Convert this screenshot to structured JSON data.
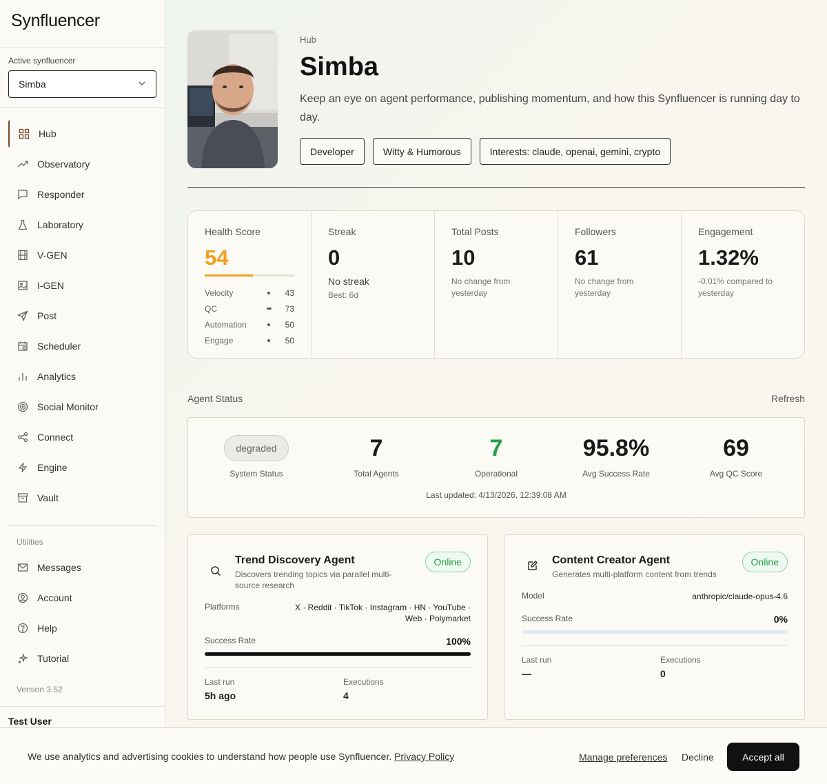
{
  "app": {
    "brand": "Synfluencer"
  },
  "sidebar": {
    "active_label": "Active synfluencer",
    "active_value": "Simba",
    "items": [
      {
        "label": "Hub",
        "icon": "grid-icon"
      },
      {
        "label": "Observatory",
        "icon": "trend-icon"
      },
      {
        "label": "Responder",
        "icon": "chat-icon"
      },
      {
        "label": "Laboratory",
        "icon": "flask-icon"
      },
      {
        "label": "V-GEN",
        "icon": "film-icon"
      },
      {
        "label": "I-GEN",
        "icon": "image-icon"
      },
      {
        "label": "Post",
        "icon": "send-icon"
      },
      {
        "label": "Scheduler",
        "icon": "calendar-icon"
      },
      {
        "label": "Analytics",
        "icon": "bar-chart-icon"
      },
      {
        "label": "Social Monitor",
        "icon": "radar-icon"
      },
      {
        "label": "Connect",
        "icon": "share-icon"
      },
      {
        "label": "Engine",
        "icon": "bolt-icon"
      },
      {
        "label": "Vault",
        "icon": "archive-icon"
      }
    ],
    "utilities_label": "Utilities",
    "utilities": [
      {
        "label": "Messages",
        "icon": "mail-icon"
      },
      {
        "label": "Account",
        "icon": "user-circle-icon"
      },
      {
        "label": "Help",
        "icon": "help-icon"
      },
      {
        "label": "Tutorial",
        "icon": "sparkle-icon"
      }
    ],
    "version": "Version 3.52",
    "user": "Test User"
  },
  "profile": {
    "section": "Hub",
    "name": "Simba",
    "description": "Keep an eye on agent performance, publishing momentum, and how this Synfluencer is running day to day.",
    "tags": [
      "Developer",
      "Witty & Humorous",
      "Interests: claude, openai, gemini, crypto"
    ]
  },
  "stats": {
    "health": {
      "label": "Health Score",
      "value": "54",
      "fill": 0.54,
      "breakdown": [
        {
          "label": "Velocity",
          "value": "43"
        },
        {
          "label": "QC",
          "value": "73"
        },
        {
          "label": "Automation",
          "value": "50"
        },
        {
          "label": "Engage",
          "value": "50"
        }
      ]
    },
    "streak": {
      "label": "Streak",
      "value": "0",
      "sub": "No streak",
      "note": "Best: 6d"
    },
    "posts": {
      "label": "Total Posts",
      "value": "10",
      "note": "No change from yesterday"
    },
    "followers": {
      "label": "Followers",
      "value": "61",
      "note": "No change from yesterday"
    },
    "engagement": {
      "label": "Engagement",
      "value": "1.32%",
      "note": "-0.01% compared to yesterday"
    }
  },
  "agent_status": {
    "title": "Agent Status",
    "refresh": "Refresh",
    "system_status": "degraded",
    "system_status_label": "System Status",
    "total_agents": "7",
    "total_agents_label": "Total Agents",
    "operational": "7",
    "operational_label": "Operational",
    "avg_success": "95.8%",
    "avg_success_label": "Avg Success Rate",
    "avg_qc": "69",
    "avg_qc_label": "Avg QC Score",
    "updated": "Last updated: 4/13/2026, 12:39:08 AM"
  },
  "agents": [
    {
      "name": "Trend Discovery Agent",
      "description": "Discovers trending topics via parallel multi-source research",
      "status": "Online",
      "meta_label": "Platforms",
      "meta_value": "X · Reddit · TikTok · Instagram · HN · YouTube · Web · Polymarket",
      "success_label": "Success Rate",
      "success_value": "100%",
      "success_fill": 1.0,
      "last_run_label": "Last run",
      "last_run": "5h ago",
      "executions_label": "Executions",
      "executions": "4"
    },
    {
      "name": "Content Creator Agent",
      "description": "Generates multi-platform content from trends",
      "status": "Online",
      "meta_label": "Model",
      "meta_value": "anthropic/claude-opus-4.6",
      "success_label": "Success Rate",
      "success_value": "0%",
      "success_fill": 0.0,
      "last_run_label": "Last run",
      "last_run": "—",
      "executions_label": "Executions",
      "executions": "0"
    }
  ],
  "cookie": {
    "text": "We use analytics and advertising cookies to understand how people use Synfluencer.",
    "policy": "Privacy Policy",
    "manage": "Manage preferences",
    "decline": "Decline",
    "accept": "Accept all"
  }
}
